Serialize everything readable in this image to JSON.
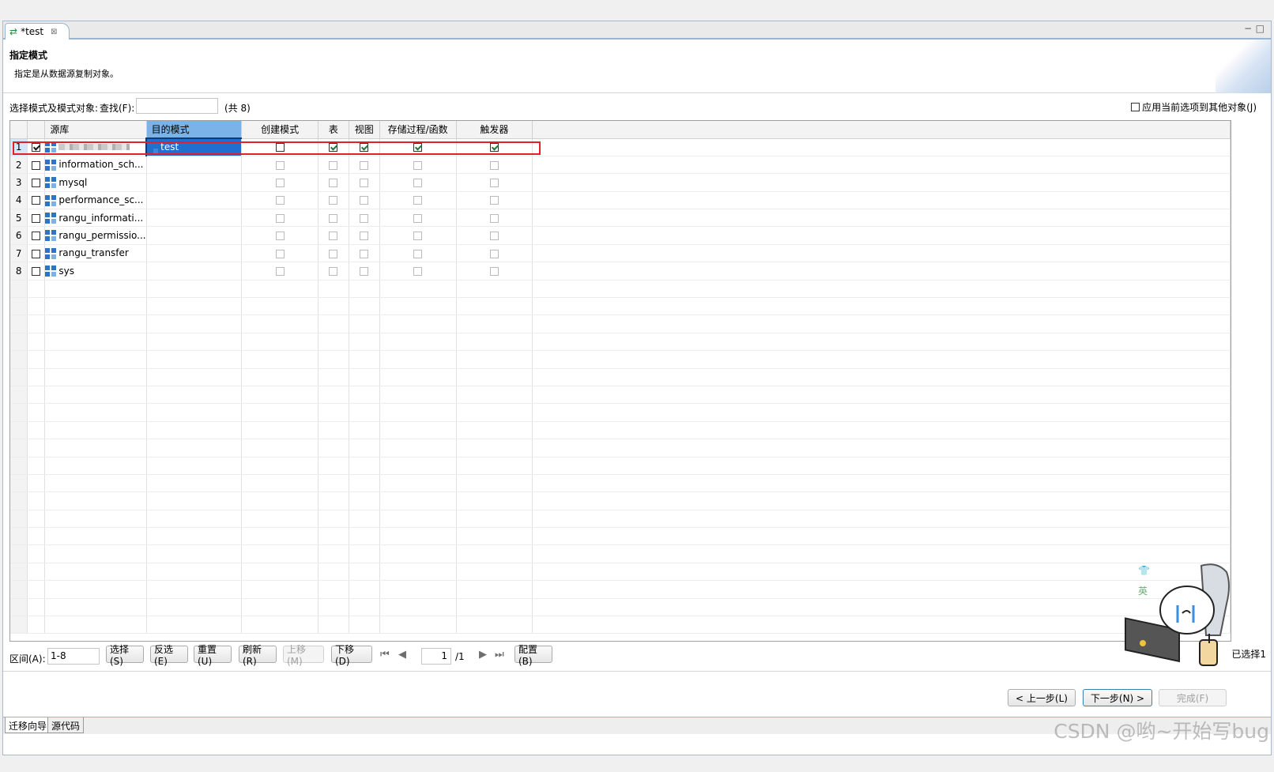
{
  "tab": {
    "title": "*test",
    "close": "⊠"
  },
  "window_controls": {
    "minimize": "−",
    "maximize": "□"
  },
  "header": {
    "title": "指定模式",
    "description": "指定是从数据源复制对象。"
  },
  "toolbar": {
    "select_label": "选择模式及模式对象:",
    "search_label": "查找(F):",
    "search_value": "",
    "count": "(共 8)",
    "apply_label": "应用当前选项到其他对象(J)",
    "apply_checked": false
  },
  "columns": [
    "源库",
    "目的模式",
    "创建模式",
    "表",
    "视图",
    "存储过程/函数",
    "触发器"
  ],
  "rows": [
    {
      "num": "1",
      "checked": true,
      "source": "",
      "source_blurred": true,
      "dest": "test",
      "create": false,
      "table": true,
      "view": true,
      "proc": true,
      "trigger": true,
      "enabled": true
    },
    {
      "num": "2",
      "checked": false,
      "source": "information_sch...",
      "dest": "",
      "create": false,
      "table": false,
      "view": false,
      "proc": false,
      "trigger": false,
      "enabled": false
    },
    {
      "num": "3",
      "checked": false,
      "source": "mysql",
      "dest": "",
      "create": false,
      "table": false,
      "view": false,
      "proc": false,
      "trigger": false,
      "enabled": false
    },
    {
      "num": "4",
      "checked": false,
      "source": "performance_sc...",
      "dest": "",
      "create": false,
      "table": false,
      "view": false,
      "proc": false,
      "trigger": false,
      "enabled": false
    },
    {
      "num": "5",
      "checked": false,
      "source": "rangu_informati...",
      "dest": "",
      "create": false,
      "table": false,
      "view": false,
      "proc": false,
      "trigger": false,
      "enabled": false
    },
    {
      "num": "6",
      "checked": false,
      "source": "rangu_permissio...",
      "dest": "",
      "create": false,
      "table": false,
      "view": false,
      "proc": false,
      "trigger": false,
      "enabled": false
    },
    {
      "num": "7",
      "checked": false,
      "source": "rangu_transfer",
      "dest": "",
      "create": false,
      "table": false,
      "view": false,
      "proc": false,
      "trigger": false,
      "enabled": false
    },
    {
      "num": "8",
      "checked": false,
      "source": "sys",
      "dest": "",
      "create": false,
      "table": false,
      "view": false,
      "proc": false,
      "trigger": false,
      "enabled": false
    }
  ],
  "bottombar": {
    "range_label": "区间(A):",
    "range_value": "1-8",
    "select_btn": "选择(S)",
    "invert_btn": "反选(E)",
    "reset_btn": "重置(U)",
    "refresh_btn": "刷新(R)",
    "move_up_btn": "上移(M)",
    "move_down_btn": "下移(D)",
    "page_value": "1",
    "page_total": "/1",
    "config_btn": "配置(B)",
    "selected_text": "已选择1"
  },
  "footer": {
    "prev_btn": "< 上一步(L)",
    "next_btn": "下一步(N) >",
    "finish_btn": "完成(F)"
  },
  "bottom_tabs": [
    "迁移向导",
    "源代码"
  ],
  "mascot_label": "英",
  "watermark": "CSDN @哟~开始写bug",
  "colors": {
    "header_selected": "#7ab3e8",
    "dest_cell": "#1f6fd1",
    "highlight_border": "#e0202a"
  }
}
